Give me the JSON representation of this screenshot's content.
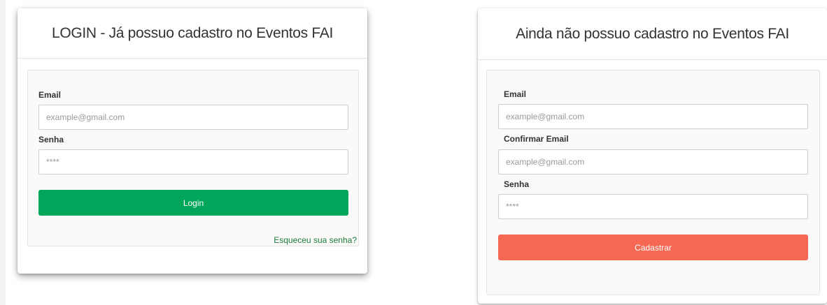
{
  "login": {
    "title": "LOGIN - Já possuo cadastro no Eventos FAI",
    "email_label": "Email",
    "email_placeholder": "example@gmail.com",
    "password_label": "Senha",
    "password_placeholder": "****",
    "submit_label": "Login",
    "forgot_link": "Esqueceu sua senha?"
  },
  "register": {
    "title": "Ainda não possuo cadastro no Eventos FAI",
    "email_label": "Email",
    "email_placeholder": "example@gmail.com",
    "confirm_email_label": "Confirmar Email",
    "confirm_email_placeholder": "example@gmail.com",
    "password_label": "Senha",
    "password_placeholder": "****",
    "submit_label": "Cadastrar"
  },
  "colors": {
    "login_button": "#00a65a",
    "register_button": "#f56954",
    "link": "#1a7a3e"
  }
}
